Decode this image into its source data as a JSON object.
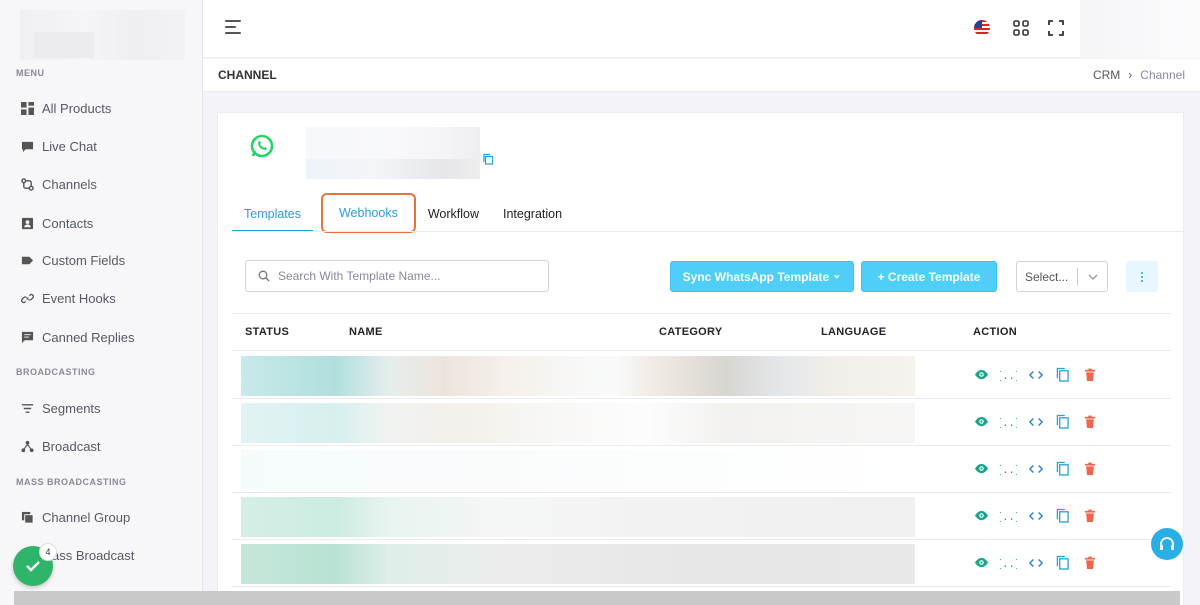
{
  "sidebar": {
    "sections": [
      {
        "title": "MENU",
        "items": [
          {
            "label": "All Products",
            "icon": "grid-icon"
          },
          {
            "label": "Live Chat",
            "icon": "chat-icon"
          },
          {
            "label": "Channels",
            "icon": "channels-icon"
          },
          {
            "label": "Contacts",
            "icon": "contact-card-icon"
          },
          {
            "label": "Custom Fields",
            "icon": "tag-icon"
          },
          {
            "label": "Event Hooks",
            "icon": "link-icon"
          },
          {
            "label": "Canned Replies",
            "icon": "message-icon"
          }
        ]
      },
      {
        "title": "BROADCASTING",
        "items": [
          {
            "label": "Segments",
            "icon": "filter-icon"
          },
          {
            "label": "Broadcast",
            "icon": "broadcast-icon"
          }
        ]
      },
      {
        "title": "MASS BROADCASTING",
        "items": [
          {
            "label": "Channel Group",
            "icon": "group-icon"
          },
          {
            "label": "ass Broadcast",
            "icon": "mass-broadcast-icon"
          }
        ]
      }
    ]
  },
  "header": {
    "page_title": "CHANNEL",
    "breadcrumb": [
      "CRM",
      "›",
      "Channel"
    ]
  },
  "channel": {
    "tabs": [
      "Templates",
      "Webhooks",
      "Workflow",
      "Integration"
    ]
  },
  "toolbar": {
    "search_placeholder": "Search With Template Name...",
    "sync_label": "Sync WhatsApp Template",
    "sync_chevron": "⌄",
    "create_label": "+ Create Template",
    "select_label": "Select..."
  },
  "table": {
    "columns": [
      "STATUS",
      "NAME",
      "CATEGORY",
      "LANGUAGE",
      "ACTION"
    ],
    "row_actions": [
      "view-icon",
      "variables-icon",
      "code-icon",
      "copy-icon",
      "delete-icon"
    ],
    "row_count": 5
  },
  "floating": {
    "badge_count": "4"
  },
  "colors": {
    "accent": "#4fcef7",
    "tab_active": "#2a9fd6",
    "highlight_border": "#e8733a",
    "action_green": "#17a689",
    "action_blue": "#2a9fd6",
    "action_red": "#f0654b",
    "whatsapp": "#25d366"
  }
}
